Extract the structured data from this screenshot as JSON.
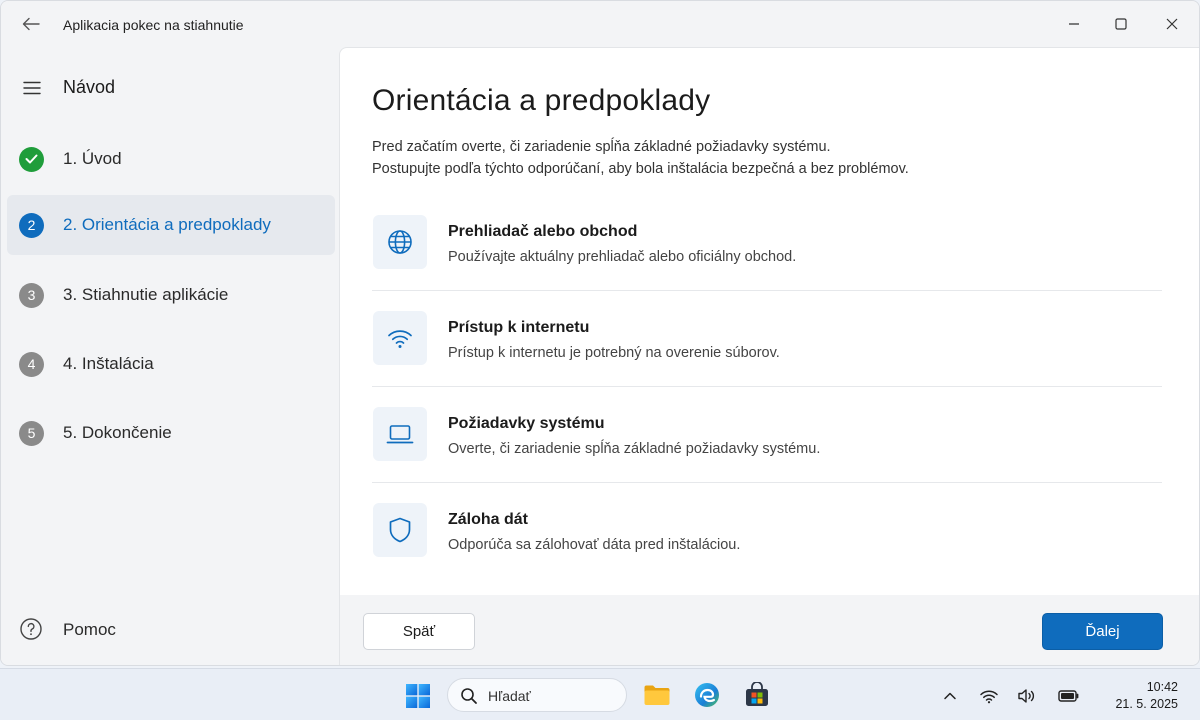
{
  "window": {
    "title": "Aplikacia pokec na stiahnutie"
  },
  "sidebar": {
    "title": "Návod",
    "steps": [
      {
        "number": "1",
        "label": "1. Úvod",
        "state": "done"
      },
      {
        "number": "2",
        "label": "2. Orientácia a predpoklady",
        "state": "current"
      },
      {
        "number": "3",
        "label": "3. Stiahnutie aplikácie",
        "state": "pending"
      },
      {
        "number": "4",
        "label": "4. Inštalácia",
        "state": "pending"
      },
      {
        "number": "5",
        "label": "5. Dokončenie",
        "state": "pending"
      }
    ],
    "help_label": "Pomoc"
  },
  "main": {
    "title": "Orientácia a predpoklady",
    "intro_line1": "Pred začatím overte, či zariadenie spĺňa základné požiadavky systému.",
    "intro_line2": "Postupujte podľa týchto odporúčaní, aby bola inštalácia bezpečná a bez problémov.",
    "items": [
      {
        "icon": "globe-icon",
        "title": "Prehliadač alebo obchod",
        "desc": "Používajte aktuálny prehliadač alebo oficiálny obchod."
      },
      {
        "icon": "wifi-icon",
        "title": "Prístup k internetu",
        "desc": "Prístup k internetu je potrebný na overenie súborov."
      },
      {
        "icon": "laptop-icon",
        "title": "Požiadavky systému",
        "desc": "Overte, či zariadenie spĺňa základné požiadavky systému."
      },
      {
        "icon": "shield-icon",
        "title": "Záloha dát",
        "desc": "Odporúča sa zálohovať dáta pred inštaláciou."
      }
    ]
  },
  "footer": {
    "back_label": "Späť",
    "next_label": "Ďalej"
  },
  "taskbar": {
    "search_placeholder": "Hľadať",
    "time": "10:42",
    "date": "21. 5. 2025"
  },
  "colors": {
    "accent": "#0f6cbd",
    "done": "#1f9d3b",
    "pending": "#8a8a8a"
  }
}
